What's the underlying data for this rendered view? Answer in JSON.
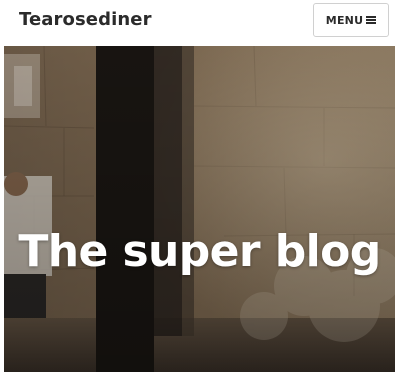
{
  "header": {
    "site_title": "Tearosediner",
    "menu_label": "MENU",
    "menu_icon": "hamburger-icon"
  },
  "hero": {
    "title": "The super blog",
    "image_description_icon": "photo-background"
  },
  "colors": {
    "text_dark": "#2b2b2b",
    "header_bg": "#ffffff",
    "hero_text": "#ffffff",
    "hero_overlay": "#4a3a2a"
  }
}
